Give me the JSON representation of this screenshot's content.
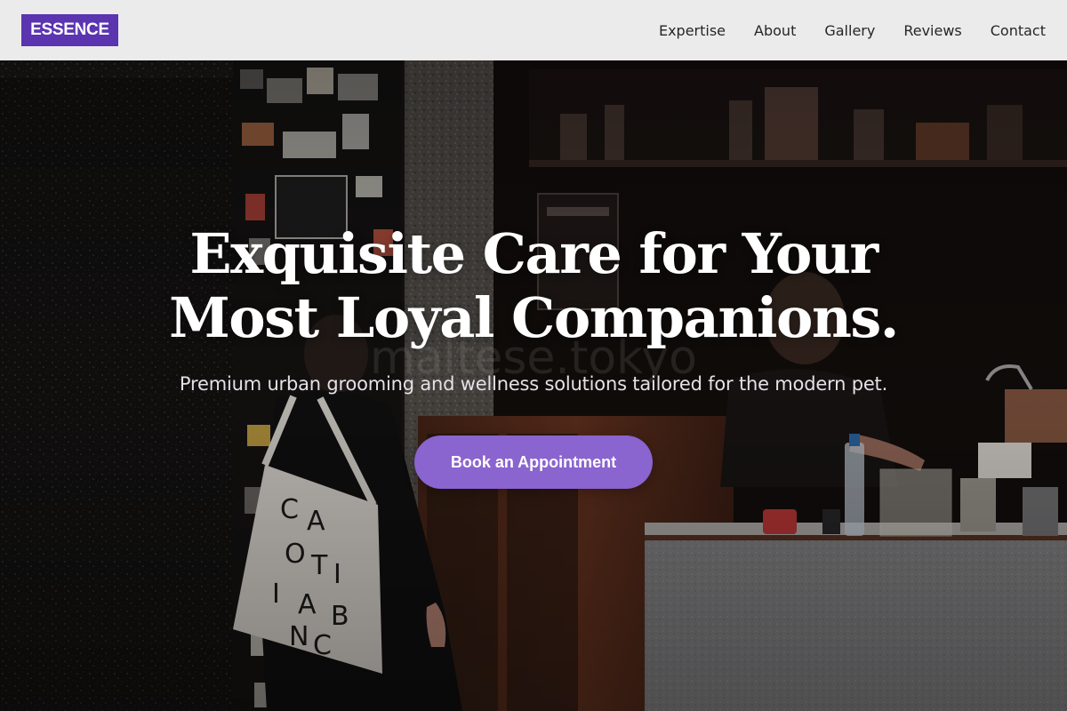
{
  "brand": {
    "logo_text": "ESSENCE",
    "accent_color": "#5b34b0"
  },
  "nav": {
    "items": [
      {
        "label": "Expertise"
      },
      {
        "label": "About"
      },
      {
        "label": "Gallery"
      },
      {
        "label": "Reviews"
      },
      {
        "label": "Contact"
      }
    ]
  },
  "hero": {
    "title_line_1": "Exquisite Care for Your",
    "title_line_2": "Most Loyal Companions.",
    "subtitle": "Premium urban grooming and wellness solutions tailored for the modern pet.",
    "cta_label": "Book an Appointment",
    "cta_color": "#8a64cf",
    "background_image": "dim photo of an urban pet grooming shop interior with a customer carrying a tote bag"
  }
}
